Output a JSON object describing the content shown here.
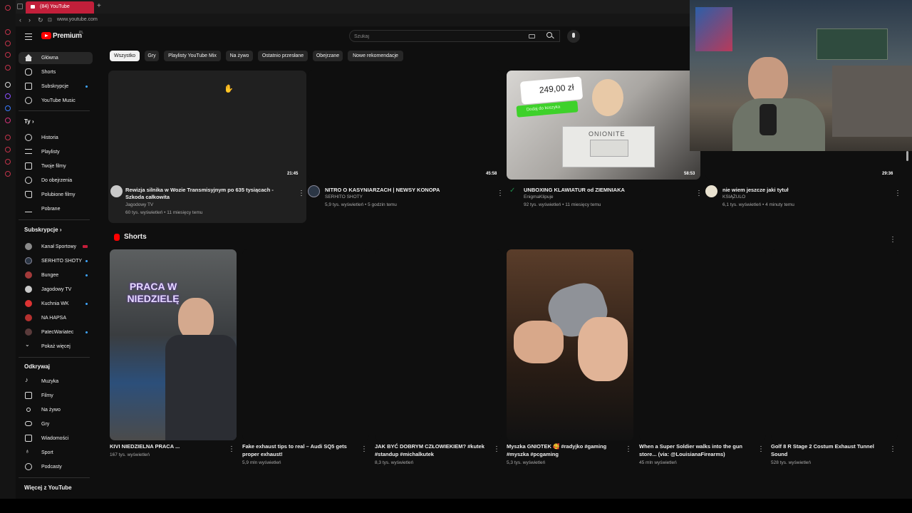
{
  "browser": {
    "tab_title": "(84) YouTube",
    "url": "www.youtube.com"
  },
  "header": {
    "logo_text": "Premium",
    "logo_sup": "PL",
    "search_placeholder": "Szukaj"
  },
  "sidebar": {
    "main": [
      {
        "label": "Główna",
        "icon": "home-icon"
      },
      {
        "label": "Shorts",
        "icon": "shorts-icon"
      },
      {
        "label": "Subskrypcje",
        "icon": "subscriptions-icon"
      },
      {
        "label": "YouTube Music",
        "icon": "music-icon"
      }
    ],
    "you_heading": "Ty",
    "you": [
      {
        "label": "Historia",
        "icon": "history-icon"
      },
      {
        "label": "Playlisty",
        "icon": "playlists-icon"
      },
      {
        "label": "Twoje filmy",
        "icon": "your-videos-icon"
      },
      {
        "label": "Do obejrzenia",
        "icon": "watch-later-icon"
      },
      {
        "label": "Polubione filmy",
        "icon": "liked-icon"
      },
      {
        "label": "Pobrane",
        "icon": "download-icon"
      }
    ],
    "subs_heading": "Subskrypcje",
    "subs": [
      {
        "label": "Kanał Sportowy",
        "color": "#8a8a8a",
        "badge": "live"
      },
      {
        "label": "SERHITO SHOTY",
        "color": "#2b3645",
        "badge": "dot"
      },
      {
        "label": "Bungee",
        "color": "#a33a3a",
        "badge": "dot"
      },
      {
        "label": "Jagodowy TV",
        "color": "#c9c9c9",
        "badge": ""
      },
      {
        "label": "Kuchnia WK",
        "color": "#d33",
        "badge": "dot"
      },
      {
        "label": "NA HAPSA",
        "color": "#b5312f",
        "badge": ""
      },
      {
        "label": "PatecWariatec",
        "color": "#5a3b3b",
        "badge": "dot"
      }
    ],
    "show_more": "Pokaż więcej",
    "explore_heading": "Odkrywaj",
    "explore": [
      {
        "label": "Muzyka",
        "icon": "music-note-icon"
      },
      {
        "label": "Filmy",
        "icon": "film-icon"
      },
      {
        "label": "Na żywo",
        "icon": "live-icon"
      },
      {
        "label": "Gry",
        "icon": "gaming-icon"
      },
      {
        "label": "Wiadomości",
        "icon": "news-icon"
      },
      {
        "label": "Sport",
        "icon": "trophy-icon"
      },
      {
        "label": "Podcasty",
        "icon": "podcast-icon"
      }
    ],
    "more_heading": "Więcej z YouTube"
  },
  "chips": [
    "Wszystko",
    "Gry",
    "Playlisty YouTube Mix",
    "Na żywo",
    "Ostatnio przesłane",
    "Obejrzane",
    "Nowe rekomendacje"
  ],
  "videos": [
    {
      "title": "Rewizja silnika w Wozie Transmisyjnym po 635 tysiącach - Szkoda całkowita",
      "channel": "Jagodowy TV",
      "meta": "60 tys. wyświetleń • 11 miesięcy temu",
      "duration": "21:45",
      "avatar": "#c9c9c9"
    },
    {
      "title": "NITRO O KASYNIARZACH | NEWSY KONOPA",
      "channel": "SERHITO SHOTY",
      "meta": "5,9 tys. wyświetleń • 5 godzin temu",
      "duration": "45:58",
      "avatar": "#2b3645"
    },
    {
      "title": "UNBOXING KLAWIATUR od ZIEMNIAKA",
      "channel": "EnigmaKlipuje",
      "meta": "92 tys. wyświetleń • 11 miesięcy temu",
      "duration": "58:53",
      "avatar": "#1e8a4a",
      "price": "249,00 zł",
      "price_btn": "Dodaj do koszyka",
      "brand": "ONIONITE"
    },
    {
      "title": "nie wiem jeszcze jaki tytuł",
      "channel": "KSIĄŻULO",
      "meta": "6,1 tys. wyświetleń • 4 minuty temu",
      "duration": "29:36",
      "avatar": "#e9e2d0"
    }
  ],
  "shorts_heading": "Shorts",
  "shorts": [
    {
      "title": "KIVI NIEDZIELNA PRACA ...",
      "views": "167 tys. wyświetleń",
      "overlay": "PRACA W NIEDZIELĘ"
    },
    {
      "title": "Fake exhaust tips to real – Audi SQ5 gets proper exhaust!",
      "views": "5,9 mln wyświetleń"
    },
    {
      "title": "JAK BYĆ DOBRYM CZŁOWIEKIEM? #kutek #standup #michalkutek",
      "views": "8,3 tys. wyświetleń"
    },
    {
      "title": "Myszka GNIOTEK 🥰 #radyjko #gaming #myszka #pcgaming",
      "views": "5,3 tys. wyświetleń"
    },
    {
      "title": "When a Super Soldier walks into the gun store... (via: @LouisianaFirearms)",
      "views": "45 mln wyświetleń"
    },
    {
      "title": "Golf 8 R Stage 2 Costum Exhaust Tunnel Sound",
      "views": "528 tys. wyświetleń"
    }
  ]
}
